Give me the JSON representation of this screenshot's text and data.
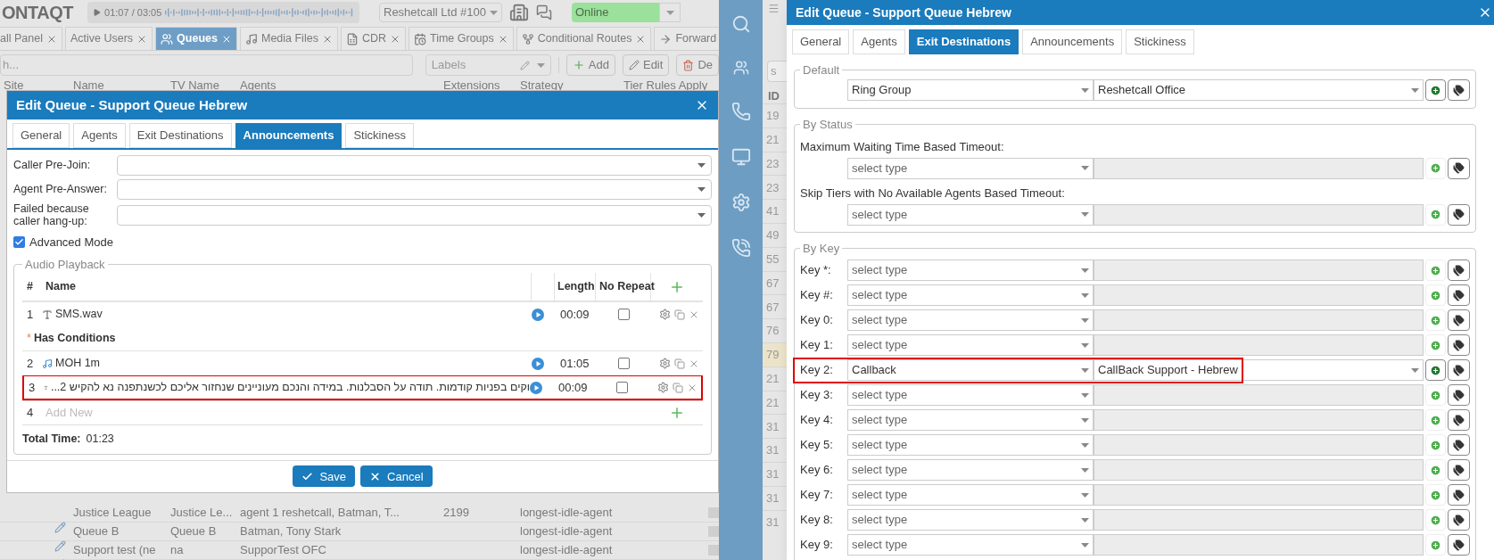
{
  "app": {
    "logo": "ONTAQT",
    "player": {
      "time": "01:07 / 03:05"
    },
    "account": "Reshetcall Ltd #100",
    "status": "Online",
    "tabs": [
      {
        "label": "all Panel",
        "selected": false
      },
      {
        "label": "Active Users",
        "selected": false
      },
      {
        "label": "Queues",
        "selected": true
      },
      {
        "label": "Media Files",
        "selected": false
      },
      {
        "label": "CDR",
        "selected": false
      },
      {
        "label": "Time Groups",
        "selected": false
      },
      {
        "label": "Conditional Routes",
        "selected": false
      },
      {
        "label": "Forward",
        "selected": false
      }
    ],
    "toolbar": {
      "search_placeholder": "h...",
      "labels_placeholder": "Labels",
      "buttons": [
        {
          "label": "Add",
          "kind": "add"
        },
        {
          "label": "Edit",
          "kind": "edit"
        },
        {
          "label": "De",
          "kind": "delete"
        }
      ]
    },
    "table": {
      "columns": [
        "Site",
        "Name",
        "TV Name",
        "Agents",
        "Extensions",
        "Strategy",
        "Tier Rules Apply"
      ],
      "rows": [
        {
          "cells": [
            "",
            "Justice League",
            "Justice Le...",
            "agent 1 reshetcall, Batman, T...",
            "2199",
            "longest-idle-agent"
          ],
          "tier_rules_apply": false
        },
        {
          "cells": [
            "",
            "Queue B",
            "Queue B",
            "Batman, Tony Stark",
            "",
            "longest-idle-agent"
          ],
          "tier_rules_apply": false
        },
        {
          "cells": [
            "",
            "Support test (ne",
            "na",
            "SupporTest OFC",
            "",
            "longest-idle-agent"
          ],
          "tier_rules_apply": false
        }
      ]
    }
  },
  "side_list": {
    "search_placeholder": "s",
    "column": "ID",
    "rows": [
      {
        "id": "19",
        "selected": false
      },
      {
        "id": "21",
        "selected": false
      },
      {
        "id": "23",
        "selected": false
      },
      {
        "id": "23",
        "selected": false
      },
      {
        "id": "41",
        "selected": false
      },
      {
        "id": "49",
        "selected": false
      },
      {
        "id": "55",
        "selected": false
      },
      {
        "id": "67",
        "selected": false
      },
      {
        "id": "67",
        "selected": false
      },
      {
        "id": "76",
        "selected": false
      },
      {
        "id": "79",
        "selected": true
      },
      {
        "id": "21",
        "selected": false
      },
      {
        "id": "21",
        "selected": false
      },
      {
        "id": "31",
        "selected": false
      },
      {
        "id": "31",
        "selected": false
      },
      {
        "id": "31",
        "selected": false
      },
      {
        "id": "31",
        "selected": false
      },
      {
        "id": "31",
        "selected": false
      }
    ]
  },
  "left_dialog": {
    "title": "Edit Queue - Support Queue Hebrew",
    "tabs": [
      {
        "label": "General",
        "selected": false
      },
      {
        "label": "Agents",
        "selected": false
      },
      {
        "label": "Exit Destinations",
        "selected": false
      },
      {
        "label": "Announcements",
        "selected": true
      },
      {
        "label": "Stickiness",
        "selected": false
      }
    ],
    "fields": [
      {
        "label": "Caller Pre-Join:"
      },
      {
        "label": "Agent Pre-Answer:"
      },
      {
        "label": "Failed because caller hang-up:"
      }
    ],
    "advanced_mode": {
      "label": "Advanced Mode",
      "checked": true
    },
    "audio_playback": {
      "legend": "Audio Playback",
      "columns": [
        "#",
        "Name",
        "Length",
        "No Repeat"
      ],
      "rows": [
        {
          "kind": "item",
          "number": "1",
          "name": "SMS.wav",
          "length": "00:09",
          "no_repeat": false,
          "highlighted": false
        },
        {
          "kind": "group",
          "marker": "*",
          "label": "Has Conditions"
        },
        {
          "kind": "item",
          "number": "2",
          "name": "MOH 1m",
          "length": "01:05",
          "no_repeat": false,
          "highlighted": false
        },
        {
          "kind": "item",
          "number": "3",
          "name": "...וקים בפניות קודמות. תודה על הסבלנות. במידה והנכם מעוניינים שנחזור אליכם לכשנתפנה נא להקיש 2",
          "length": "00:09",
          "no_repeat": false,
          "highlighted": true
        },
        {
          "kind": "new",
          "number": "4",
          "placeholder": "Add New"
        }
      ],
      "total": {
        "label": "Total Time:",
        "value": "01:23"
      }
    },
    "buttons": [
      {
        "label": "Save",
        "kind": "save"
      },
      {
        "label": "Cancel",
        "kind": "cancel"
      }
    ]
  },
  "right_dialog": {
    "title": "Edit Queue - Support Queue Hebrew",
    "tabs": [
      {
        "label": "General",
        "selected": false
      },
      {
        "label": "Agents",
        "selected": false
      },
      {
        "label": "Exit Destinations",
        "selected": true
      },
      {
        "label": "Announcements",
        "selected": false
      },
      {
        "label": "Stickiness",
        "selected": false
      }
    ],
    "default": {
      "legend": "Default",
      "type": "Ring Group",
      "destination": "Reshetcall Office"
    },
    "by_status": {
      "legend": "By Status",
      "rows": [
        {
          "label": "Maximum Waiting Time Based Timeout:",
          "type_placeholder": "select type"
        },
        {
          "label": "Skip Tiers with No Available Agents Based Timeout:",
          "type_placeholder": "select type"
        }
      ]
    },
    "by_key": {
      "legend": "By Key",
      "rows": [
        {
          "label": "Key *:",
          "type_placeholder": "select type",
          "highlighted": false
        },
        {
          "label": "Key #:",
          "type_placeholder": "select type",
          "highlighted": false
        },
        {
          "label": "Key 0:",
          "type_placeholder": "select type",
          "highlighted": false
        },
        {
          "label": "Key 1:",
          "type_placeholder": "select type",
          "highlighted": false
        },
        {
          "label": "Key 2:",
          "type": "Callback",
          "destination": "CallBack Support - Hebrew",
          "highlighted": true
        },
        {
          "label": "Key 3:",
          "type_placeholder": "select type",
          "highlighted": false
        },
        {
          "label": "Key 4:",
          "type_placeholder": "select type",
          "highlighted": false
        },
        {
          "label": "Key 5:",
          "type_placeholder": "select type",
          "highlighted": false
        },
        {
          "label": "Key 6:",
          "type_placeholder": "select type",
          "highlighted": false
        },
        {
          "label": "Key 7:",
          "type_placeholder": "select type",
          "highlighted": false
        },
        {
          "label": "Key 8:",
          "type_placeholder": "select type",
          "highlighted": false
        },
        {
          "label": "Key 9:",
          "type_placeholder": "select type",
          "highlighted": false
        }
      ]
    }
  }
}
